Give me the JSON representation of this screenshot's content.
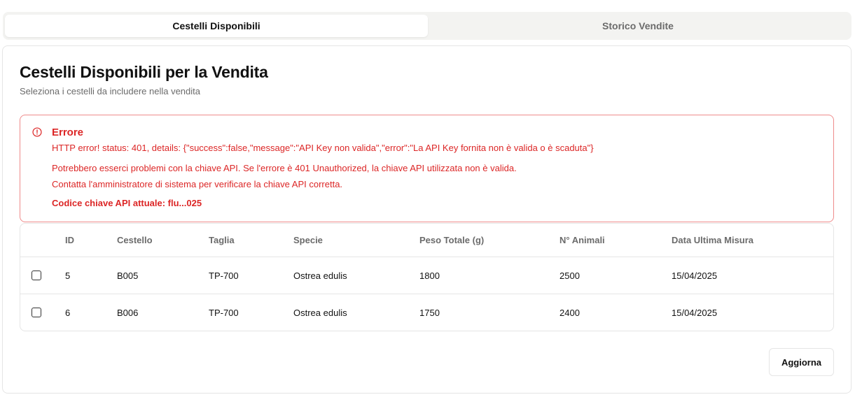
{
  "tabs": [
    {
      "label": "Cestelli Disponibili",
      "active": true
    },
    {
      "label": "Storico Vendite",
      "active": false
    }
  ],
  "card": {
    "title": "Cestelli Disponibili per la Vendita",
    "subtitle": "Seleziona i cestelli da includere nella vendita"
  },
  "error": {
    "icon": "alert-circle-icon",
    "title": "Errore",
    "message": "HTTP error! status: 401, details: {\"success\":false,\"message\":\"API Key non valida\",\"error\":\"La API Key fornita non è valida o è scaduta\"}",
    "hint1": "Potrebbero esserci problemi con la chiave API. Se l'errore è 401 Unauthorized, la chiave API utilizzata non è valida.",
    "hint2": "Contatta l'amministratore di sistema per verificare la chiave API corretta.",
    "key_info": "Codice chiave API attuale: flu...025",
    "color": "#dc2626"
  },
  "table": {
    "headers": {
      "id": "ID",
      "cestello": "Cestello",
      "taglia": "Taglia",
      "specie": "Specie",
      "peso": "Peso Totale (g)",
      "animali": "N° Animali",
      "data": "Data Ultima Misura"
    },
    "rows": [
      {
        "checked": false,
        "id": "5",
        "cestello": "B005",
        "taglia": "TP-700",
        "specie": "Ostrea edulis",
        "peso": "1800",
        "animali": "2500",
        "data": "15/04/2025"
      },
      {
        "checked": false,
        "id": "6",
        "cestello": "B006",
        "taglia": "TP-700",
        "specie": "Ostrea edulis",
        "peso": "1750",
        "animali": "2400",
        "data": "15/04/2025"
      }
    ]
  },
  "actions": {
    "refresh_label": "Aggiorna"
  }
}
